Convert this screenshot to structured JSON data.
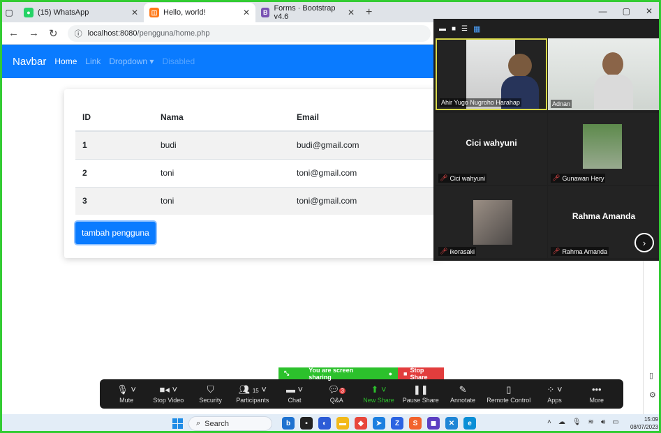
{
  "browser": {
    "tabs": [
      {
        "label": "(15) WhatsApp",
        "color": "#25d366"
      },
      {
        "label": "Hello, world!",
        "color": "#ff7a1a"
      },
      {
        "label": "Forms · Bootstrap v4.6",
        "color": "#7952b3"
      }
    ],
    "url_host": "localhost:8080",
    "url_path": "/pengguna/home.php"
  },
  "navbar": {
    "brand": "Navbar",
    "links": [
      "Home",
      "Link",
      "Dropdown ▾",
      "Disabled"
    ]
  },
  "table": {
    "headers": [
      "ID",
      "Nama",
      "Email"
    ],
    "rows": [
      [
        "1",
        "budi",
        "budi@gmail.com"
      ],
      [
        "2",
        "toni",
        "toni@gmail.com"
      ],
      [
        "3",
        "toni",
        "toni@gmail.com"
      ]
    ]
  },
  "add_button": "tambah pengguna",
  "zoom": {
    "participants": [
      "Ahir Yugo Nugroho Harahap",
      "Adnan",
      "Cici wahyuni",
      "Gunawan Hery",
      "ikorasaki",
      "Rahma Amanda"
    ],
    "center_names": [
      "Cici wahyuni",
      "Rahma Amanda"
    ],
    "share_status": "You are screen sharing",
    "stop_share": "Stop Share",
    "toolbar": [
      {
        "label": "Mute",
        "icon": "mic-icon"
      },
      {
        "label": "Stop Video",
        "icon": "video-icon"
      },
      {
        "label": "Security",
        "icon": "shield-icon"
      },
      {
        "label": "Participants",
        "icon": "participants-icon",
        "count": "15"
      },
      {
        "label": "Chat",
        "icon": "chat-icon"
      },
      {
        "label": "Q&A",
        "icon": "qa-icon",
        "badge": "3"
      },
      {
        "label": "New Share",
        "icon": "share-icon"
      },
      {
        "label": "Pause Share",
        "icon": "pause-icon"
      },
      {
        "label": "Annotate",
        "icon": "pen-icon"
      },
      {
        "label": "Remote Control",
        "icon": "mouse-icon"
      },
      {
        "label": "Apps",
        "icon": "apps-icon"
      },
      {
        "label": "More",
        "icon": "more-icon"
      }
    ]
  },
  "taskbar": {
    "search": "Search",
    "time": "15:09",
    "date": "08/07/2023"
  }
}
